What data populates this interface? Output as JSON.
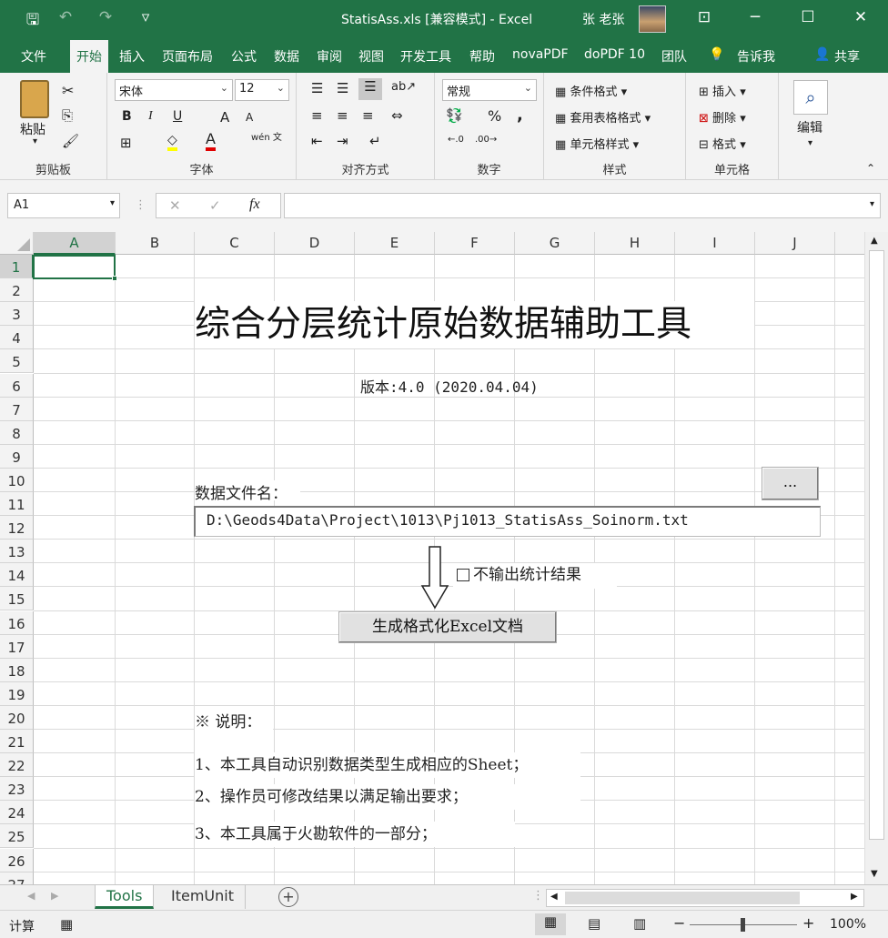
{
  "window": {
    "file_title": "StatisAss.xls  [兼容模式]  -  Excel",
    "user_name": "张 老张",
    "icons": [
      "save-icon",
      "undo-icon",
      "redo-icon",
      "customize-qat-icon",
      "ribbon-display-icon",
      "minimize-icon",
      "maximize-icon",
      "close-icon"
    ],
    "glyphs": {
      "save": "🖫",
      "undo": "↶",
      "redo": "↷",
      "customize": "▿",
      "ribbon": "⊡",
      "min": "─",
      "max": "☐",
      "close": "✕"
    }
  },
  "tabs": [
    "文件",
    "开始",
    "插入",
    "页面布局",
    "公式",
    "数据",
    "审阅",
    "视图",
    "开发工具",
    "帮助",
    "novaPDF",
    "doPDF 10",
    "团队"
  ],
  "tell_me": "告诉我",
  "share": "共享",
  "ribbon": {
    "clipboard": {
      "label": "剪贴板",
      "paste": "粘贴"
    },
    "font": {
      "label": "字体",
      "name": "宋体",
      "size": "12",
      "bold": "B",
      "italic": "I",
      "underline": "U",
      "grow": "A",
      "shrink": "A",
      "fontcolor": "A",
      "wen": "wén 文"
    },
    "align": {
      "label": "对齐方式"
    },
    "number": {
      "label": "数字",
      "format": "常规",
      "percent": "%",
      "comma": ","
    },
    "styles": {
      "label": "样式",
      "cond": "条件格式",
      "table": "套用表格格式",
      "cell": "单元格样式"
    },
    "cells": {
      "label": "单元格",
      "insert": "插入",
      "delete": "删除",
      "format": "格式"
    },
    "edit": {
      "label": "编辑"
    }
  },
  "formula_bar": {
    "name_box": "A1",
    "fx": "fx",
    "cancel": "✕",
    "enter": "✓",
    "formula": ""
  },
  "columns": [
    "A",
    "B",
    "C",
    "D",
    "E",
    "F",
    "G",
    "H",
    "I",
    "J"
  ],
  "rows": [
    "1",
    "2",
    "3",
    "4",
    "5",
    "6",
    "7",
    "8",
    "9",
    "10",
    "11",
    "12",
    "13",
    "14",
    "15",
    "16",
    "17",
    "18",
    "19",
    "20",
    "21",
    "22",
    "23",
    "24",
    "25",
    "26",
    "27"
  ],
  "sheet": {
    "title": "综合分层统计原始数据辅助工具",
    "version": "版本:4.0 (2020.04.04)",
    "file_label": "数据文件名：",
    "browse_button": "...",
    "file_path": "D:\\Geods4Data\\Project\\1013\\Pj1013_StatisAss_Soinorm.txt",
    "checkbox_label": "不输出统计结果",
    "checkbox_checked": false,
    "generate_button": "生成格式化Excel文档",
    "notes_heading": "※ 说明：",
    "notes": [
      "1、本工具自动识别数据类型生成相应的Sheet；",
      "2、操作员可修改结果以满足输出要求；",
      "3、本工具属于火勘软件的一部分；"
    ]
  },
  "sheet_tabs": [
    "Tools",
    "ItemUnit"
  ],
  "active_sheet": "Tools",
  "status": {
    "mode": "计算",
    "zoom": "100%",
    "zoom_minus": "−",
    "zoom_plus": "+"
  },
  "colors": {
    "excel_green": "#217346",
    "ribbon_bg": "#f3f3f3"
  }
}
